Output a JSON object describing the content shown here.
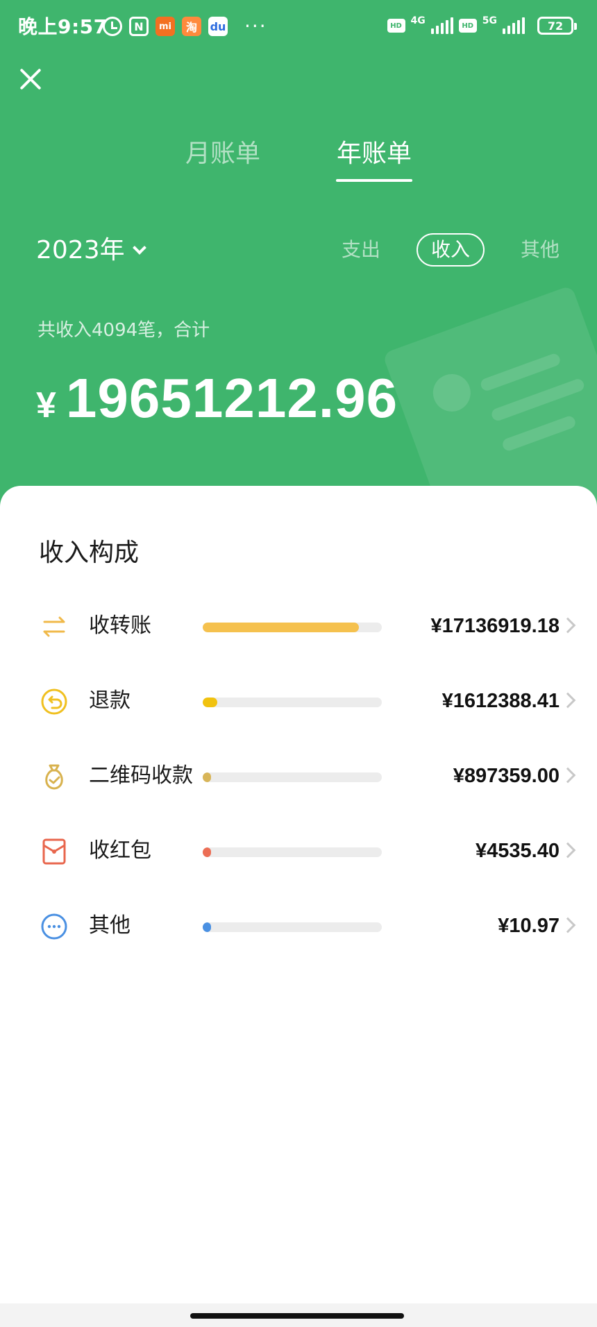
{
  "status_bar": {
    "time": "晚上9:57",
    "icons": [
      "alarm-icon",
      "nfc-icon",
      "mi-app-icon",
      "taobao-app-icon",
      "baidu-app-icon"
    ],
    "more": "···",
    "hd_label": "HD",
    "net1": "4G",
    "net2": "5G",
    "battery": "72"
  },
  "header": {
    "close_icon": "close-icon",
    "tabs": [
      {
        "label": "月账单",
        "active": false
      },
      {
        "label": "年账单",
        "active": true
      }
    ],
    "year": "2023年",
    "filters": [
      {
        "label": "支出",
        "active": false
      },
      {
        "label": "收入",
        "active": true
      },
      {
        "label": "其他",
        "active": false
      }
    ],
    "summary": "共收入4094笔，合计",
    "currency": "¥",
    "total": "19651212.96"
  },
  "colors": {
    "header_bg": "#3fb56d",
    "bar_transfer": "#f5c14e",
    "bar_refund": "#f1c20f",
    "bar_qr": "#d8b558",
    "bar_redpacket": "#ec6e55",
    "bar_other": "#4a90e2"
  },
  "breakdown": {
    "title": "收入构成",
    "items": [
      {
        "icon": "transfer-arrows-icon",
        "label": "收转账",
        "amount": "¥17136919.18",
        "fraction": 0.872
      },
      {
        "icon": "refund-icon",
        "label": "退款",
        "amount": "¥1612388.41",
        "fraction": 0.082
      },
      {
        "icon": "money-bag-icon",
        "label": "二维码收款",
        "amount": "¥897359.00",
        "fraction": 0.046
      },
      {
        "icon": "red-packet-icon",
        "label": "收红包",
        "amount": "¥4535.40",
        "fraction": 0.0002
      },
      {
        "icon": "more-dots-icon",
        "label": "其他",
        "amount": "¥10.97",
        "fraction": 0.0
      }
    ]
  }
}
